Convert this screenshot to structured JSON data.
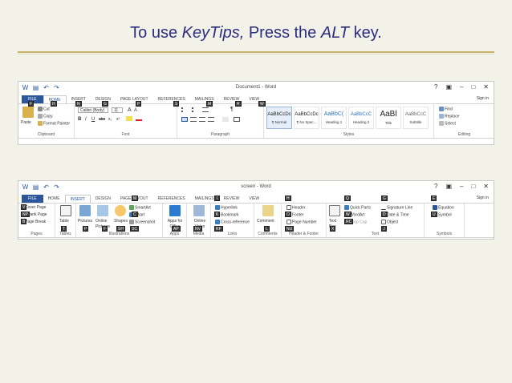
{
  "slide": {
    "title_a": "To use ",
    "title_b": "KeyTips,",
    "title_c": " Press the ",
    "title_d": "ALT",
    "title_e": " key."
  },
  "home_window": {
    "title": "Document1 - Word",
    "controls": [
      "?",
      "▣",
      "–",
      "□",
      "✕"
    ],
    "tabs": [
      "FILE",
      "HOME",
      "INSERT",
      "DESIGN",
      "PAGE LAYOUT",
      "REFERENCES",
      "MAILINGS",
      "REVIEW",
      "VIEW"
    ],
    "active_tab": "HOME",
    "signin": "Sign in",
    "keytips_tabs": [
      "F",
      "H",
      "N",
      "G",
      "P",
      "S",
      "M",
      "R",
      "W"
    ],
    "clipboard": {
      "paste": "Paste",
      "cut": "Cut",
      "copy": "Copy",
      "format_painter": "Format Painter",
      "label": "Clipboard"
    },
    "font": {
      "font_name": "Calibri (Body)",
      "font_size": "11",
      "label": "Font",
      "grow": "A",
      "shrink": "A",
      "bold": "B",
      "italic": "I",
      "underline": "U",
      "strike": "abc",
      "sub": "x₂",
      "sup": "x²"
    },
    "paragraph": {
      "label": "Paragraph",
      "pilcrow": "¶"
    },
    "styles": {
      "label": "Styles",
      "items": [
        {
          "sample": "AaBbCcDc",
          "name": "¶ Normal"
        },
        {
          "sample": "AaBbCcDc",
          "name": "¶ No Spac..."
        },
        {
          "sample": "AaBbC(",
          "name": "Heading 1"
        },
        {
          "sample": "AaBbCcC",
          "name": "Heading 2"
        },
        {
          "sample": "AaBl",
          "name": "Title"
        },
        {
          "sample": "AaBbCcC",
          "name": "Subtitle"
        }
      ]
    },
    "editing": {
      "find": "Find",
      "replace": "Replace",
      "select": "Select",
      "label": "Editing"
    }
  },
  "insert_window": {
    "title": "screen - Word",
    "controls": [
      "?",
      "▣",
      "–",
      "□",
      "✕"
    ],
    "tabs": [
      "FILE",
      "HOME",
      "INSERT",
      "DESIGN",
      "PAGE LAYOUT",
      "REFERENCES",
      "MAILINGS",
      "REVIEW",
      "VIEW"
    ],
    "active_tab": "INSERT",
    "signin": "Sign in",
    "pages": {
      "cover": "Cover Page",
      "blank": "Blank Page",
      "break": "Page Break",
      "label": "Pages"
    },
    "tables": {
      "table": "Table",
      "label": "Tables"
    },
    "illustrations": {
      "pictures": "Pictures",
      "online": "Online Pictures",
      "shapes": "Shapes",
      "smartart": "SmartArt",
      "chart": "Chart",
      "screenshot": "Screenshot",
      "label": "Illustrations"
    },
    "apps": {
      "apps": "Apps for Office",
      "label": "Apps"
    },
    "media": {
      "video": "Online Video",
      "label": "Media"
    },
    "links": {
      "hyperlink": "Hyperlink",
      "bookmark": "Bookmark",
      "cross": "Cross-reference",
      "label": "Links"
    },
    "comments": {
      "comment": "Comment",
      "label": "Comments"
    },
    "header_footer": {
      "header": "Header",
      "footer": "Footer",
      "page_number": "Page Number",
      "label": "Header & Footer"
    },
    "text": {
      "textbox": "Text Box",
      "quickparts": "Quick Parts",
      "wordart": "WordArt",
      "dropcap": "Drop Cap",
      "sigline": "Signature Line",
      "datetime": "Date & Time",
      "object": "Object",
      "label": "Text"
    },
    "symbols": {
      "equation": "Equation",
      "symbol": "Symbol",
      "label": "Symbols"
    },
    "keytips": [
      "V",
      "NP",
      "B",
      "T",
      "P",
      "F",
      "SH",
      "SC",
      "M",
      "C",
      "AP",
      "NV",
      "I",
      "K",
      "RF",
      "L",
      "H",
      "O",
      "NU",
      "X",
      "Q",
      "W",
      "RC",
      "G",
      "D",
      "J",
      "E",
      "U"
    ]
  },
  "colors": {
    "file_blue": "#2b579a",
    "title_blue": "#2c2c80",
    "keytip_bg": "#3c3c3c",
    "rule": "#c8b56a"
  }
}
